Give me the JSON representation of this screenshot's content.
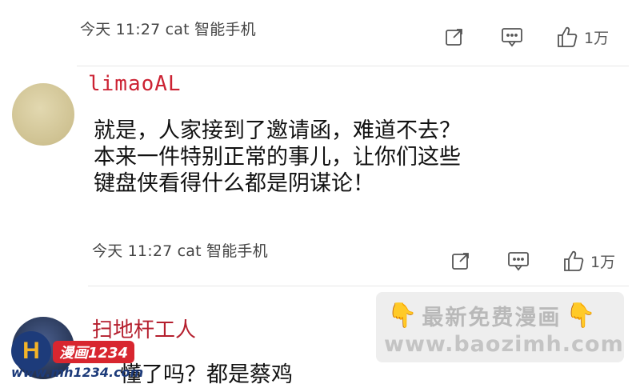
{
  "comments": [
    {
      "meta": "今天 11:27 cat 智能手机",
      "like_count": "1万"
    },
    {
      "username": "limaoAL",
      "text_lines": [
        "就是，人家接到了邀请函，难道不去？",
        "本来一件特别正常的事儿，让你们这些",
        "键盘侠看得什么都是阴谋论！"
      ],
      "meta": "今天 11:27 cat 智能手机",
      "like_count": "1万"
    },
    {
      "username": "扫地杆工人",
      "text_partial": "懂了吗？都是蔡鸡"
    }
  ],
  "watermark": {
    "line1": "最新免费漫画",
    "line2": "www.baozimh.com"
  },
  "site_logo": {
    "badge": "漫画1234",
    "url": "www.mh1234.com"
  },
  "colors": {
    "username": "#c8323c",
    "watermark_text": "#bdbdbd",
    "logo_red": "#d8262f",
    "logo_blue": "#1d3b7a"
  },
  "icons": [
    "share-icon",
    "comment-icon",
    "thumbs-up-icon",
    "pointing-down-hand-icon"
  ]
}
